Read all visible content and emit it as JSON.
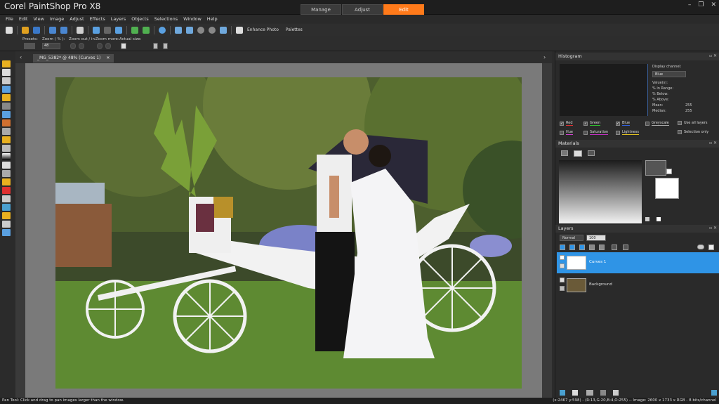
{
  "app": {
    "title": "Corel PaintShop Pro X8"
  },
  "mode_tabs": [
    {
      "label": "Manage"
    },
    {
      "label": "Adjust"
    },
    {
      "label": "Edit"
    }
  ],
  "window_buttons": {
    "minimize": "–",
    "restore": "❐",
    "close": "✕"
  },
  "menu": [
    "File",
    "Edit",
    "View",
    "Image",
    "Adjust",
    "Effects",
    "Layers",
    "Objects",
    "Selections",
    "Window",
    "Help"
  ],
  "toolbar": {
    "enhance_photo": "Enhance Photo",
    "palettes": "Palettes"
  },
  "options": {
    "presets_label": "Presets:",
    "zoom_pct_label": "Zoom ( % ):",
    "zoom_value": "48",
    "zoom_out_label": "Zoom out / in:",
    "zoom_more_label": "Zoom more:",
    "actual_size_label": "Actual size:"
  },
  "document": {
    "tab_label": "_MG_5382* @  48% (Curves 1)",
    "close": "✕"
  },
  "histogram": {
    "title": "Histogram",
    "display_channel_label": "Display channel:",
    "display_channel_value": "Blue",
    "values_label": "Value(s):",
    "in_range_label": "% in Range:",
    "below_label": "% Below:",
    "above_label": "% Above:",
    "mean_label": "Mean:",
    "mean_value": "255",
    "median_label": "Median:",
    "median_value": "255",
    "checks_row1": [
      {
        "label": "Red",
        "checked": true,
        "color": "#e03030"
      },
      {
        "label": "Green",
        "checked": true,
        "color": "#30c030"
      },
      {
        "label": "Blue",
        "checked": true,
        "color": "#3060e0"
      },
      {
        "label": "Greyscale",
        "checked": false,
        "color": "#aaaaaa"
      },
      {
        "label": "Use all layers",
        "checked": false,
        "color": ""
      }
    ],
    "checks_row2": [
      {
        "label": "Hue",
        "checked": false,
        "color": "#d040d0"
      },
      {
        "label": "Saturation",
        "checked": false,
        "color": "#c030c0"
      },
      {
        "label": "Lightness",
        "checked": false,
        "color": "#e0c020"
      },
      {
        "label": "Selection only",
        "checked": false,
        "color": ""
      }
    ]
  },
  "materials": {
    "title": "Materials"
  },
  "layers": {
    "title": "Layers",
    "blend_mode": "Normal",
    "opacity": "100",
    "items": [
      {
        "name": "Curves 1",
        "selected": true
      },
      {
        "name": "Background",
        "selected": false
      }
    ]
  },
  "status": {
    "left": "Pan Tool: Click and drag to pan images larger than the window.",
    "right": "(x:2467 y:598) - (R:13,G:20,B:4,O:255) -- Image:  2600 x 1733 x RGB - 8 bits/channel"
  },
  "colors": {
    "accent": "#ff7a1a",
    "selection": "#2f94e6"
  }
}
